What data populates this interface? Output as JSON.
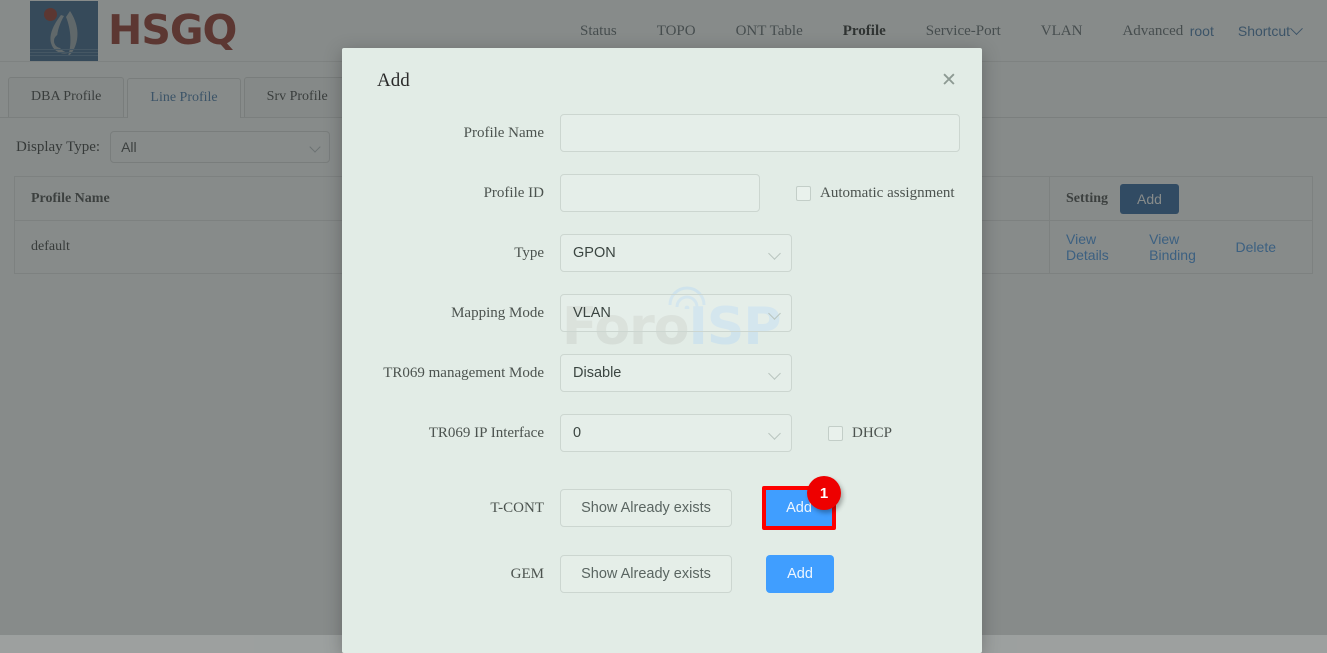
{
  "brand": {
    "name": "HSGQ",
    "logo_icon": "hsgq-logo-icon"
  },
  "topnav": {
    "items": [
      {
        "label": "Status",
        "active": false
      },
      {
        "label": "TOPO",
        "active": false
      },
      {
        "label": "ONT Table",
        "active": false
      },
      {
        "label": "Profile",
        "active": true
      },
      {
        "label": "Service-Port",
        "active": false
      },
      {
        "label": "VLAN",
        "active": false
      },
      {
        "label": "Advanced",
        "active": false
      }
    ],
    "user": "root",
    "shortcut": "Shortcut",
    "shortcut_icon": "chevron-down-icon"
  },
  "tabs": [
    {
      "label": "DBA Profile",
      "active": false
    },
    {
      "label": "Line Profile",
      "active": true
    },
    {
      "label": "Srv Profile",
      "active": false
    }
  ],
  "filter": {
    "label": "Display Type:",
    "value": "All",
    "chevron_icon": "chevron-down-icon"
  },
  "table": {
    "columns": [
      "Profile Name",
      "",
      "",
      "Setting"
    ],
    "header_add_button": "Add",
    "rows": [
      {
        "profile_name": "default",
        "actions": [
          "View Details",
          "View Binding",
          "Delete"
        ]
      }
    ]
  },
  "watermark": {
    "part1": "Foro",
    "part2": "ISP",
    "icon": "wifi-arc-icon"
  },
  "dialog": {
    "title": "Add",
    "close_icon": "close-icon",
    "fields": [
      {
        "label": "Profile Name",
        "value": "",
        "placeholder": "",
        "kind": "text"
      },
      {
        "label": "Profile ID",
        "value": "",
        "placeholder": "",
        "kind": "text",
        "side_checkbox": {
          "label": "Automatic assignment",
          "checked": false
        }
      },
      {
        "label": "Type",
        "value": "GPON",
        "kind": "select",
        "chevron_icon": "chevron-down-icon"
      },
      {
        "label": "Mapping Mode",
        "value": "VLAN",
        "kind": "select",
        "chevron_icon": "chevron-down-icon"
      },
      {
        "label": "TR069 management Mode",
        "value": "Disable",
        "kind": "select",
        "chevron_icon": "chevron-down-icon"
      },
      {
        "label": "TR069 IP Interface",
        "value": "0",
        "kind": "select",
        "chevron_icon": "chevron-down-icon",
        "side_checkbox": {
          "label": "DHCP",
          "checked": false
        }
      },
      {
        "label": "T-CONT",
        "show_button": "Show Already exists",
        "add_button": "Add",
        "kind": "buttons",
        "highlighted": true
      },
      {
        "label": "GEM",
        "show_button": "Show Already exists",
        "add_button": "Add",
        "kind": "buttons",
        "highlighted": false
      }
    ]
  },
  "annotation": {
    "badge_number": "1"
  },
  "colors": {
    "brand_red": "#8e2318",
    "logo_blue": "#2b5480",
    "link_blue": "#3a8ee6",
    "primary_blue": "#409eff",
    "dark_blue_button": "#1e5799",
    "dialog_bg": "#e2ece6",
    "highlight_red": "#fe0000",
    "badge_red": "#ee0000"
  }
}
